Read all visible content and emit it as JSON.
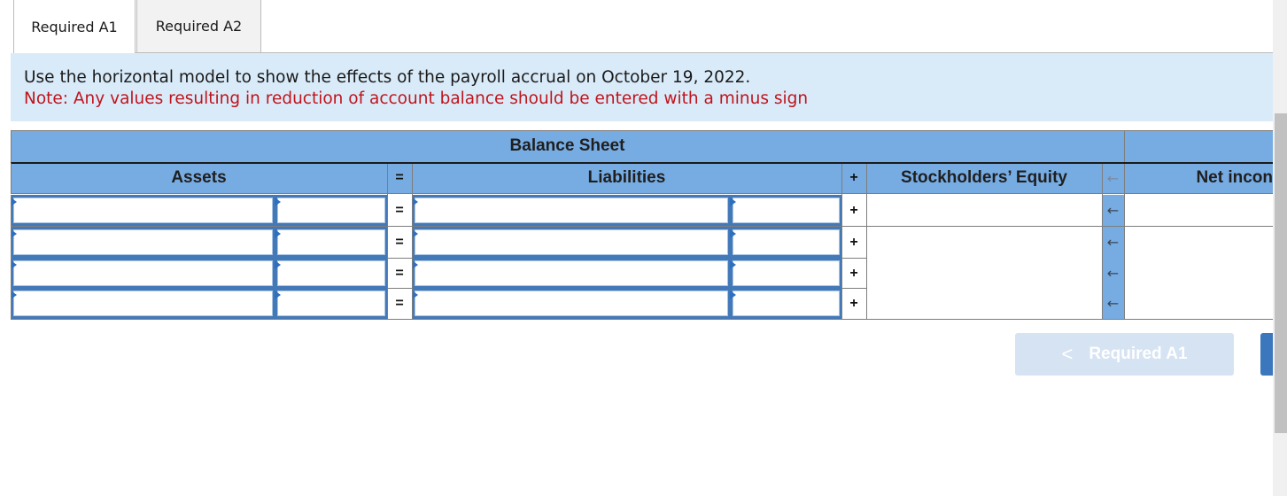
{
  "tabs": [
    {
      "label": "Required A1",
      "active": true
    },
    {
      "label": "Required A2",
      "active": false
    }
  ],
  "instructions": {
    "text": "Use the horizontal model to show the effects of the payroll accrual on October 19, 2022.",
    "note": "Note: Any values resulting in reduction of account balance should be entered with a minus sign"
  },
  "table": {
    "group_header": "Balance Sheet",
    "headers": {
      "assets": "Assets",
      "equals": "=",
      "liabilities": "Liabilities",
      "plus": "+",
      "equity": "Stockholders’ Equity",
      "arrow": "←",
      "net_income": "Net incon"
    },
    "rows": [
      {
        "asset_account": "",
        "asset_amount": "",
        "op1": "=",
        "liability_account": "",
        "liability_amount": "",
        "op2": "+",
        "equity": "",
        "arrow": "←",
        "net_income": ""
      },
      {
        "asset_account": "",
        "asset_amount": "",
        "op1": "=",
        "liability_account": "",
        "liability_amount": "",
        "op2": "+",
        "equity": "",
        "arrow": "←",
        "net_income": ""
      },
      {
        "asset_account": "",
        "asset_amount": "",
        "op1": "=",
        "liability_account": "",
        "liability_amount": "",
        "op2": "+",
        "equity": "",
        "arrow": "←",
        "net_income": ""
      },
      {
        "asset_account": "",
        "asset_amount": "",
        "op1": "=",
        "liability_account": "",
        "liability_amount": "",
        "op2": "+",
        "equity": "",
        "arrow": "←",
        "net_income": ""
      }
    ]
  },
  "navigation": {
    "prev_label": "Required A1",
    "prev_icon": "chevron-left-icon",
    "next_label": ""
  },
  "colors": {
    "header_blue": "#77ace3",
    "instruction_bg": "#d9ebf9",
    "note_red": "#c0141c",
    "input_border": "#4479b8",
    "next_button": "#3a77bd",
    "prev_button_disabled": "#d6e3f2"
  }
}
